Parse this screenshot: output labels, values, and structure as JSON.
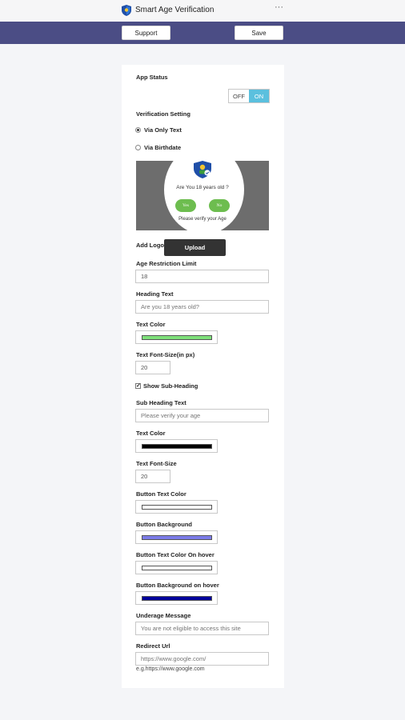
{
  "app": {
    "title": "Smart Age Verification",
    "icon": "shield-logo-icon",
    "more_icon": "more-dots-icon",
    "more_glyph": "···"
  },
  "toolbar": {
    "support_label": "Support",
    "save_label": "Save"
  },
  "settings": {
    "app_status_label": "App Status",
    "toggle_off": "OFF",
    "toggle_on": "ON",
    "app_status_value": "ON",
    "verification_label": "Verification Setting",
    "radio_text": "Via Only Text",
    "radio_birthdate": "Via Birthdate",
    "selected_verification": "Via Only Text",
    "add_logo_label": "Add Logo",
    "upload_label": "Upload",
    "age_limit_label": "Age Restriction Limit",
    "age_limit_value": "18",
    "heading_text_label": "Heading Text",
    "heading_text_placeholder": "Are you 18 years old?",
    "text_color_label": "Text Color",
    "text_color": "#7ee07a",
    "font_size_label": "Text Font-Size(in px)",
    "font_size_value": "20",
    "show_subheading_label": "Show Sub-Heading",
    "show_subheading_checked": true,
    "show_subheading_check_glyph": "✓",
    "subheading_text_label": "Sub Heading Text",
    "subheading_text_placeholder": "Please verify your age",
    "sub_text_color_label": "Text Color",
    "sub_text_color": "#000000",
    "sub_font_size_label": "Text Font-Size",
    "sub_font_size_value": "20",
    "button_text_color_label": "Button Text Color",
    "button_text_color": "#ffffff",
    "button_background_label": "Button Background",
    "button_background": "#7b7be8",
    "button_text_hover_label": "Button Text Color On hover",
    "button_text_hover": "#ffffff",
    "button_bg_hover_label": "Button Background on hover",
    "button_bg_hover": "#00009c",
    "underage_label": "Underage Message",
    "underage_placeholder": "You are not eligible to access this site",
    "redirect_label": "Redirect Url",
    "redirect_placeholder": "https://www.google.com/",
    "redirect_hint": "e.g.https://www.google.com"
  },
  "preview": {
    "question": "Are You 18 years old ?",
    "yes_label": "Yes",
    "no_label": "No",
    "subtext": "Please verify your Age",
    "button_color": "#6dbd4f",
    "overlay_color": "#6d6d6d"
  }
}
